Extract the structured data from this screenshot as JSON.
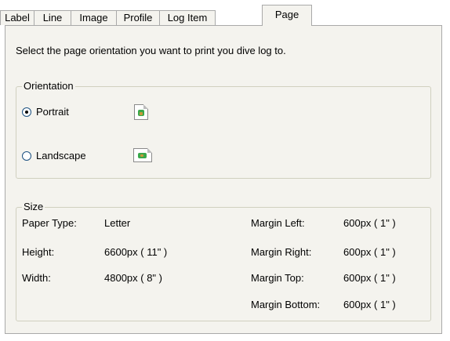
{
  "tabs": [
    {
      "label": "Label"
    },
    {
      "label": "Line"
    },
    {
      "label": "Image"
    },
    {
      "label": "Profile"
    },
    {
      "label": "Log Item"
    },
    {
      "label": "Page",
      "active": true
    }
  ],
  "instructions": "Select the page orientation you want to print you dive log to.",
  "orientation": {
    "legend": "Orientation",
    "portrait_label": "Portrait",
    "landscape_label": "Landscape",
    "selected": "Portrait"
  },
  "size": {
    "legend": "Size",
    "paper_type_label": "Paper Type:",
    "paper_type_value": "Letter",
    "height_label": "Height:",
    "height_value": "6600px ( 11\" )",
    "width_label": "Width:",
    "width_value": "4800px ( 8\" )",
    "margin_left_label": "Margin Left:",
    "margin_left_value": "600px ( 1\" )",
    "margin_right_label": "Margin Right:",
    "margin_right_value": "600px ( 1\" )",
    "margin_top_label": "Margin Top:",
    "margin_top_value": "600px ( 1\" )",
    "margin_bottom_label": "Margin Bottom:",
    "margin_bottom_value": "600px ( 1\" )"
  },
  "icons": {
    "portrait": "portrait-page-icon",
    "landscape": "landscape-page-icon"
  }
}
